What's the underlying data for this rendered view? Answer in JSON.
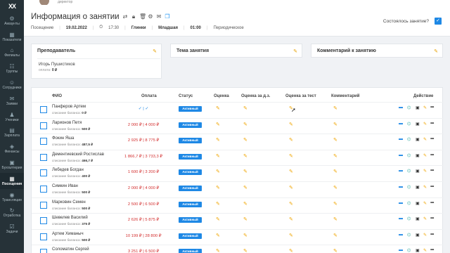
{
  "sidebar": {
    "logo": "XX",
    "items": [
      {
        "label": "Аккаунты",
        "icon": "accounts-icon",
        "glyph": "⚙"
      },
      {
        "label": "Показатели",
        "icon": "chart-icon",
        "glyph": "▦"
      },
      {
        "label": "Филиалы",
        "icon": "branches-icon",
        "glyph": "⌂"
      },
      {
        "label": "Группы",
        "icon": "groups-icon",
        "glyph": "☷"
      },
      {
        "label": "Сотрудники",
        "icon": "employees-icon",
        "glyph": "☺"
      },
      {
        "label": "Заявки",
        "icon": "requests-icon",
        "glyph": "✉"
      },
      {
        "label": "Ученики",
        "icon": "students-icon",
        "glyph": "♟"
      },
      {
        "label": "Зарплата",
        "icon": "salary-icon",
        "glyph": "▤"
      },
      {
        "label": "Финансы",
        "icon": "finance-icon",
        "glyph": "◈"
      },
      {
        "label": "Бухгалтерия",
        "icon": "accounting-icon",
        "glyph": "▣"
      },
      {
        "label": "Посещения",
        "icon": "attendance-icon",
        "glyph": "▦"
      },
      {
        "label": "Трансляции",
        "icon": "broadcast-icon",
        "glyph": "◉"
      },
      {
        "label": "Отработка",
        "icon": "makeup-icon",
        "glyph": "↻"
      },
      {
        "label": "Задачи",
        "icon": "tasks-icon",
        "glyph": "☑"
      }
    ],
    "active_index": 10
  },
  "topbar": {
    "role": "директор"
  },
  "header": {
    "title": "Информация о занятии",
    "type": "Посещение",
    "date": "19.02.2022",
    "time": "17:30",
    "branch": "Глинки",
    "group": "Младшая",
    "duration": "01:00",
    "kind": "Периодическое",
    "occurred_label": "Состоялось занятие?"
  },
  "cards": {
    "teacher": {
      "title": "Преподаватель",
      "name": "Игорь Пушистиков",
      "pay_label": "оплата:",
      "pay_value": "0 ₽"
    },
    "topic": {
      "title": "Тема занятия"
    },
    "comment": {
      "title": "Комментарий к занятию"
    }
  },
  "table": {
    "headers": {
      "name": "ФИО",
      "payment": "Оплата",
      "status": "Статус",
      "grade": "Оценка",
      "grade_hw": "Оценка за д.з.",
      "grade_test": "Оценка за тест",
      "comment": "Комментарий",
      "action": "Действие"
    },
    "balance_label": "списание баланса:",
    "rows": [
      {
        "name": "Панферов Артем",
        "balance": "0 ₽",
        "payment": "✓ | ✓",
        "paid": true,
        "status": "Активный"
      },
      {
        "name": "Ларионов Петя",
        "balance": "500 ₽",
        "payment": "2 000 ₽ | 4 000 ₽",
        "paid": false,
        "status": "Активный"
      },
      {
        "name": "Фокин Яша",
        "balance": "487,5 ₽",
        "payment": "2 925 ₽ | 8 775 ₽",
        "paid": false,
        "status": "Активный"
      },
      {
        "name": "Дементиевский Ростислав",
        "balance": "466,7 ₽",
        "payment": "1 866,7 ₽ | 3 733,3 ₽",
        "paid": false,
        "status": "Активный"
      },
      {
        "name": "Лебедев Богдан",
        "balance": "400 ₽",
        "payment": "1 600 ₽ | 3 200 ₽",
        "paid": false,
        "status": "Активный"
      },
      {
        "name": "Симкин Иван",
        "balance": "500 ₽",
        "payment": "2 000 ₽ | 4 000 ₽",
        "paid": false,
        "status": "Активный"
      },
      {
        "name": "Марковин Семен",
        "balance": "500 ₽",
        "payment": "2 500 ₽ | 6 500 ₽",
        "paid": false,
        "status": "Активный"
      },
      {
        "name": "Шевелев Василий",
        "balance": "375 ₽",
        "payment": "2 626 ₽ | 5 875 ₽",
        "paid": false,
        "status": "Активный"
      },
      {
        "name": "Артем Химаныч",
        "balance": "500 ₽",
        "payment": "10 199 ₽ | 28 800 ₽",
        "paid": false,
        "status": "Активный"
      },
      {
        "name": "Соломатин Сергей",
        "balance": "",
        "payment": "3 251 ₽ | 6 500 ₽",
        "paid": false,
        "status": "Активный"
      }
    ]
  },
  "colors": {
    "accent": "#1e88e5",
    "sidebar": "#263238",
    "debt": "#d32f2f",
    "edit": "#f0a500"
  }
}
